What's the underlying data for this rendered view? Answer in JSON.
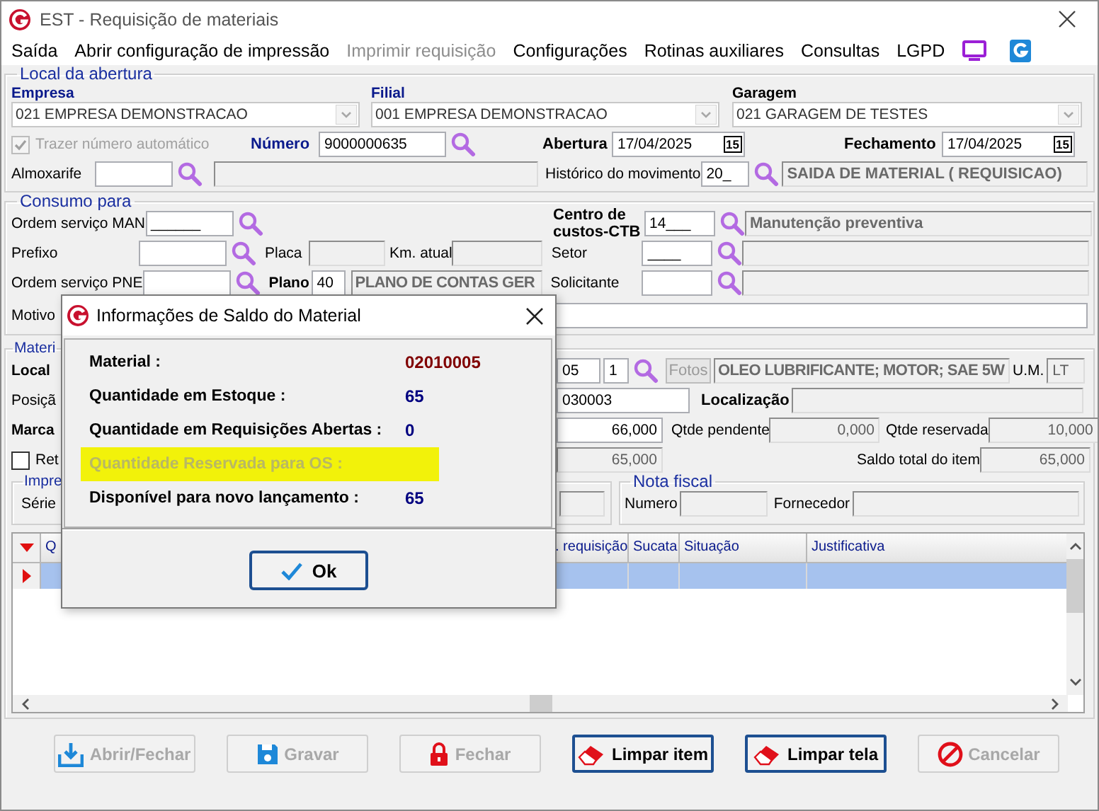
{
  "window": {
    "title": "EST - Requisição de materiais"
  },
  "menu": [
    {
      "label": "Saída",
      "disabled": false
    },
    {
      "label": "Abrir configuração de impressão",
      "disabled": false
    },
    {
      "label": "Imprimir requisição",
      "disabled": true
    },
    {
      "label": "Configurações",
      "disabled": false
    },
    {
      "label": "Rotinas auxiliares",
      "disabled": false
    },
    {
      "label": "Consultas",
      "disabled": false
    },
    {
      "label": "LGPD",
      "disabled": false
    }
  ],
  "local_abertura": {
    "legend": "Local da abertura",
    "empresa": {
      "label": "Empresa",
      "value": "021 EMPRESA DEMONSTRACAO"
    },
    "filial": {
      "label": "Filial",
      "value": "001 EMPRESA DEMONSTRACAO"
    },
    "garagem": {
      "label": "Garagem",
      "value": "021 GARAGEM DE TESTES"
    },
    "trazer_numero": {
      "label": "Trazer número automático",
      "checked": true,
      "disabled": true
    },
    "numero": {
      "label": "Número",
      "value": "9000000635"
    },
    "abertura": {
      "label": "Abertura",
      "value": "17/04/2025",
      "calendar": "15"
    },
    "fechamento": {
      "label": "Fechamento",
      "value": "17/04/2025",
      "calendar": "15"
    },
    "almoxarife": {
      "label": "Almoxarife"
    },
    "historico": {
      "label": "Histórico do movimento",
      "code": "20_",
      "description": "SAIDA DE MATERIAL ( REQUISICAO)"
    }
  },
  "consumo": {
    "legend": "Consumo para",
    "ordem_man": {
      "label": "Ordem serviço MAN",
      "value": "______"
    },
    "prefixo": {
      "label": "Prefixo"
    },
    "placa": {
      "label": "Placa"
    },
    "km_atual": {
      "label": "Km. atual"
    },
    "ordem_pne": {
      "label": "Ordem serviço PNE"
    },
    "plano": {
      "label": "Plano",
      "code": "40",
      "description": "PLANO DE CONTAS GER"
    },
    "centro_custos": {
      "label": "Centro de custos-CTB",
      "code": "14___",
      "description": "Manutenção preventiva"
    },
    "setor": {
      "label": "Setor",
      "code": "____"
    },
    "solicitante": {
      "label": "Solicitante"
    },
    "motivo": {
      "label": "Motivo"
    }
  },
  "material": {
    "legend": "Materi",
    "local_label": "Local",
    "posicao_label": "Posiçã",
    "marca_label": "Marca",
    "retorno": {
      "label": "Ret",
      "checked": false
    },
    "code": "05",
    "seq": "1",
    "fotos_button": "Fotos",
    "description": "OLEO LUBRIFICANTE; MOTOR; SAE 5W",
    "um": {
      "label": "U.M.",
      "value": "LT"
    },
    "posicao": "030003",
    "localizacao": {
      "label": "Localização"
    },
    "quantidade": "66,000",
    "qtde_pendente": {
      "label": "Qtde pendente",
      "value": "0,000"
    },
    "qtde_reservada": {
      "label": "Qtde reservada",
      "value": "10,000"
    },
    "saldo": "65,000",
    "saldo_total": {
      "label": "Saldo total do item",
      "value": "65,000"
    },
    "impressao": {
      "legend": "Impre",
      "serie_label": "Série"
    },
    "nota_fiscal": {
      "legend": "Nota fiscal",
      "numero_label": "Numero",
      "fornecedor_label": "Fornecedor"
    }
  },
  "grid": {
    "columns": [
      "Q",
      ". requisição",
      "Sucata",
      "Situação",
      "Justificativa"
    ],
    "rows": [
      {
        "selected": true
      }
    ]
  },
  "buttons": [
    {
      "label": "Abrir/Fechar",
      "kind": "open",
      "disabled": true
    },
    {
      "label": "Gravar",
      "kind": "save",
      "disabled": true
    },
    {
      "label": "Fechar",
      "kind": "lock",
      "disabled": true
    },
    {
      "label": "Limpar item",
      "kind": "eraser",
      "disabled": false
    },
    {
      "label": "Limpar tela",
      "kind": "eraser",
      "disabled": false
    },
    {
      "label": "Cancelar",
      "kind": "cancel",
      "disabled": true
    }
  ],
  "dialog": {
    "title": "Informações de Saldo do Material",
    "rows": [
      {
        "label": "Material :",
        "value": "02010005",
        "color": "#800000",
        "highlighted": false
      },
      {
        "label": "Quantidade em Estoque :",
        "value": "65",
        "color": "#000080",
        "highlighted": false
      },
      {
        "label": "Quantidade em Requisições Abertas :",
        "value": "0",
        "color": "#000080",
        "highlighted": false
      },
      {
        "label": "Quantidade Reservada para OS :",
        "highlighted": true
      },
      {
        "label": "Disponível para novo lançamento :",
        "value": "65",
        "color": "#000080",
        "highlighted": false
      }
    ],
    "ok_button": "Ok"
  }
}
